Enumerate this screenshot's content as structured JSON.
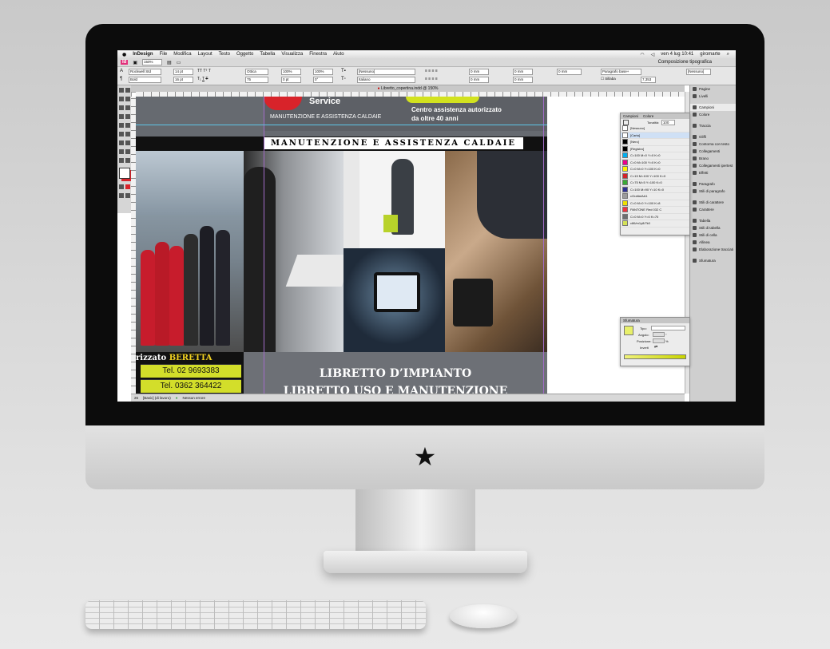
{
  "menubar": {
    "apple": "",
    "app_name": "InDesign",
    "items": [
      "File",
      "Modifica",
      "Layout",
      "Testo",
      "Oggetto",
      "Tabella",
      "Visualizza",
      "Finestra",
      "Aiuto"
    ],
    "clock": "ven 4 lug 10:41",
    "user": "giromarte"
  },
  "control": {
    "app_logo": "Id",
    "zoom": "150%",
    "workspace": "Composizione tipografica",
    "font": "Rockwell Std",
    "style": "Bold",
    "size": "14 pt",
    "leading": "16 pt",
    "kerning": "Ottica",
    "scale_v": "100%",
    "scale_h": "100%",
    "tracking": "75",
    "baseline": "0 pt",
    "skew": "0°",
    "char_style": "[Nessuno]",
    "language": "Italiano",
    "spacing_values": [
      "0 mm",
      "0 mm",
      "0 mm",
      "0 mm"
    ],
    "para_style": "Paragrafo base+",
    "col": "[Nessuno]",
    "hyphen_label": "Sillaba",
    "leading_right": "7,353"
  },
  "document": {
    "tab_title": "Libretto_copertina.indd @ 150%"
  },
  "artwork": {
    "logo_word": "Service",
    "tagline": "MANUTENZIONE E ASSISTENZA CALDAIE",
    "assist_line1": "Centro assistenza autorizzato",
    "assist_line2": "da oltre 40 anni",
    "strip_title": "MANUTENZIONE E ASSISTENZA CALDAIE",
    "beretta_prefix": "rizzato ",
    "beretta_brand": "BERETTA",
    "tel1": "Tel. 02 9693383",
    "tel2": "Tel. 0362 364422",
    "libretto_line1": "LIBRETTO D’IMPIANTO",
    "libretto_line2": "LIBRETTO USO E MANUTENZIONE"
  },
  "statusbar": {
    "page": "26",
    "profile": "[Basic] (di lavoro)",
    "errors": "Nessun errore"
  },
  "side_panel": [
    {
      "label": "Pagine",
      "icon": "pages-icon"
    },
    {
      "label": "Livelli",
      "icon": "layers-icon"
    },
    {
      "label": "Campioni",
      "icon": "swatches-icon",
      "selected": true
    },
    {
      "label": "Colore",
      "icon": "color-icon"
    },
    {
      "label": "Traccia",
      "icon": "stroke-icon"
    },
    {
      "label": "Gliffi",
      "icon": "glyphs-icon"
    },
    {
      "label": "Contorna con testo",
      "icon": "text-wrap-icon"
    },
    {
      "label": "Collegamenti",
      "icon": "links-icon"
    },
    {
      "label": "Brano",
      "icon": "story-icon"
    },
    {
      "label": "Collegamenti ipertest",
      "icon": "hyperlinks-icon"
    },
    {
      "label": "Effetti",
      "icon": "effects-icon"
    },
    {
      "label": "Paragrafo",
      "icon": "paragraph-icon"
    },
    {
      "label": "Stili di paragrafo",
      "icon": "paragraph-styles-icon"
    },
    {
      "label": "Stili di carattere",
      "icon": "character-styles-icon"
    },
    {
      "label": "Carattere",
      "icon": "character-icon"
    },
    {
      "label": "Tabella",
      "icon": "table-icon"
    },
    {
      "label": "Stili di tabella",
      "icon": "table-styles-icon"
    },
    {
      "label": "Stili di cella",
      "icon": "cell-styles-icon"
    },
    {
      "label": "Allinea",
      "icon": "align-icon"
    },
    {
      "label": "Elaborazione tracciati",
      "icon": "pathfinder-icon"
    },
    {
      "label": "Sfumatura",
      "icon": "gradient-icon"
    }
  ],
  "swatches_panel": {
    "tab1": "Campioni",
    "tab2": "Colore",
    "tint_label": "Tonalità:",
    "tint_value": "100",
    "rows": [
      {
        "name": "[Nessuno]",
        "color": "#ffffff"
      },
      {
        "name": "[Carta]",
        "color": "#ffffff"
      },
      {
        "name": "[Nero]",
        "color": "#000000"
      },
      {
        "name": "[Registro]",
        "color": "#000000"
      },
      {
        "name": "C=100 M=0 Y=0 K=0",
        "color": "#00aeef"
      },
      {
        "name": "C=0 M=100 Y=0 K=0",
        "color": "#ec008c"
      },
      {
        "name": "C=0 M=0 Y=100 K=0",
        "color": "#fff200"
      },
      {
        "name": "C=15 M=100 Y=100 K=0",
        "color": "#d2232a"
      },
      {
        "name": "C=75 M=5 Y=100 K=0",
        "color": "#3aaa35"
      },
      {
        "name": "C=100 M=90 Y=10 K=0",
        "color": "#2e3192"
      },
      {
        "name": "cGrafia/AA1",
        "color": "#9b9b9b"
      },
      {
        "name": "C=0 M=0 Y=100 K=8",
        "color": "#ede000"
      },
      {
        "name": "PANTONE Red 032 C",
        "color": "#ef3340"
      },
      {
        "name": "C=0 M=0 Y=0 K=70",
        "color": "#6d6e70"
      },
      {
        "name": "c86/m1y8/7k0",
        "color": "#d4e157"
      }
    ]
  },
  "gradient_panel": {
    "title": "Sfumatura",
    "type_label": "Tipo:",
    "angle_label": "Angolo:",
    "angle_unit": "°",
    "location_label": "Posizione:",
    "location_unit": "%",
    "reverse_label": "Inverti"
  },
  "colors": {
    "accent_yellow": "#d3de2a",
    "brand_red": "#d8232a",
    "indesign_pink": "#e22f7a"
  }
}
